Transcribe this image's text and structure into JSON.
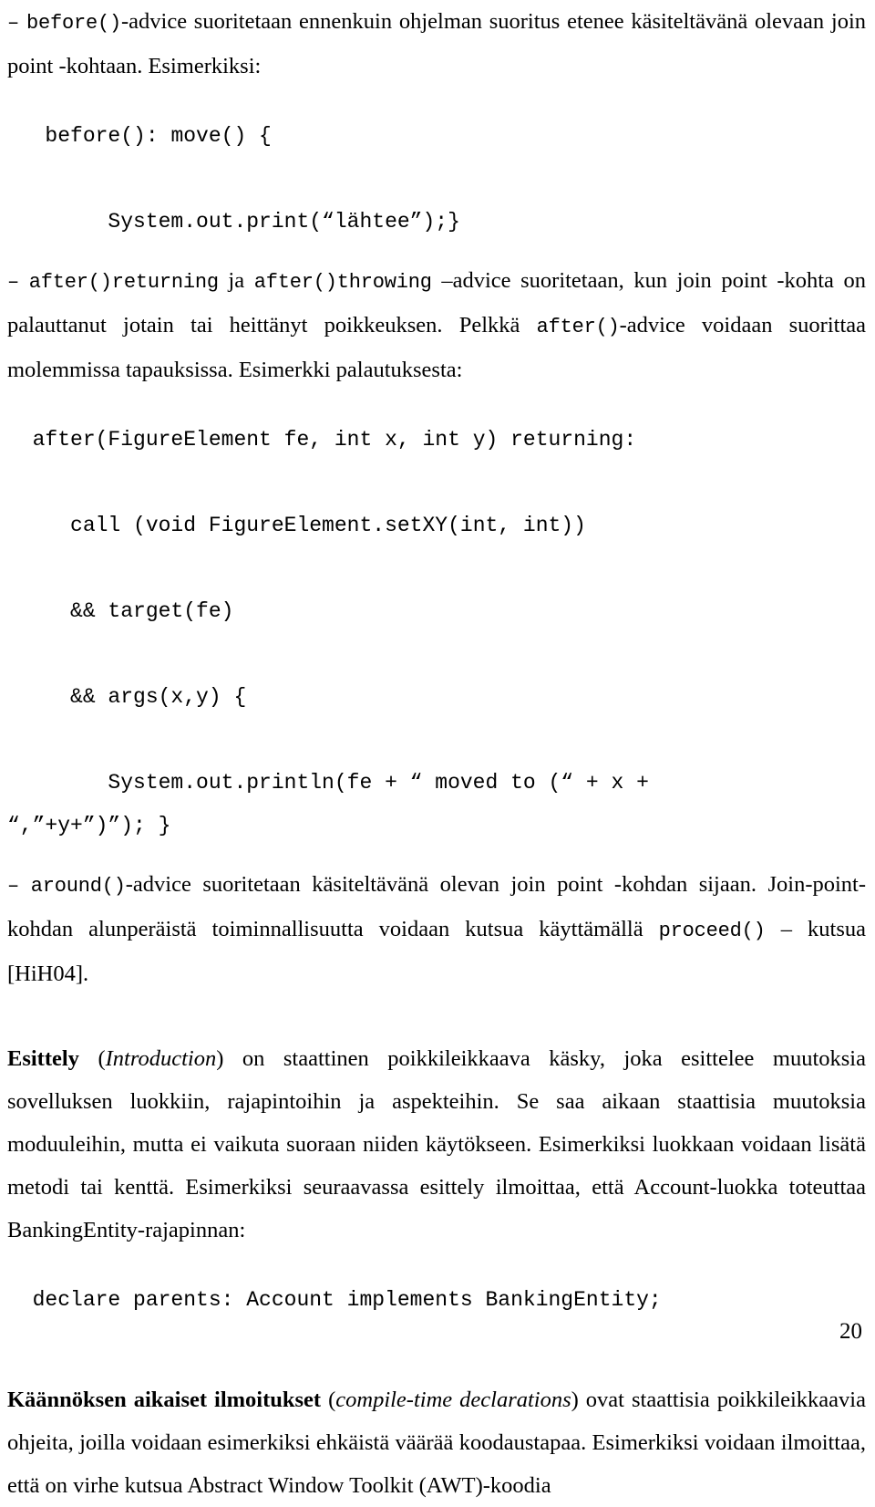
{
  "document": {
    "page_number": "20",
    "language": "fi",
    "blocks": [
      {
        "type": "bullet-paragraph",
        "dash": "–",
        "runs": [
          {
            "style": "mono",
            "text": "before()"
          },
          {
            "style": "normal",
            "text": "-advice suoritetaan ennenkuin ohjelman suoritus etenee käsiteltävänä olevaan join point -kohtaan. Esimerkiksi:"
          }
        ]
      },
      {
        "type": "code",
        "lines": [
          "   before(): move() {",
          "",
          "        System.out.print(“lähtee”);}"
        ]
      },
      {
        "type": "bullet-paragraph",
        "dash": "–",
        "runs": [
          {
            "style": "mono",
            "text": "after()returning"
          },
          {
            "style": "normal",
            "text": " ja "
          },
          {
            "style": "mono",
            "text": "after()throwing"
          },
          {
            "style": "normal",
            "text": " –advice suoritetaan, kun join point -kohta on palauttanut jotain tai heittänyt poikkeuksen. Pelkkä "
          },
          {
            "style": "mono",
            "text": "after()"
          },
          {
            "style": "normal",
            "text": "-advice voidaan suorittaa molemmissa tapauksissa. Esimerkki palautuksesta:"
          }
        ]
      },
      {
        "type": "code",
        "lines": [
          "  after(FigureElement fe, int x, int y) returning:",
          "",
          "     call (void FigureElement.setXY(int, int))",
          "",
          "     && target(fe)",
          "",
          "     && args(x,y) {",
          "",
          "        System.out.println(fe + “ moved to (“ + x +",
          "“,”+y+”)”); }"
        ]
      },
      {
        "type": "bullet-paragraph",
        "dash": "–",
        "runs": [
          {
            "style": "mono",
            "text": "around()"
          },
          {
            "style": "normal",
            "text": "-advice suoritetaan käsiteltävänä olevan join point -kohdan sijaan. Join-point-kohdan alunperäistä toiminnallisuutta voidaan kutsua käyttämällä "
          },
          {
            "style": "mono",
            "text": "proceed()"
          },
          {
            "style": "normal",
            "text": " – kutsua [HiH04]."
          }
        ]
      },
      {
        "type": "paragraph",
        "runs": [
          {
            "style": "bold",
            "text": "Esittely"
          },
          {
            "style": "normal",
            "text": " ("
          },
          {
            "style": "italic",
            "text": "Introduction"
          },
          {
            "style": "normal",
            "text": ") on staattinen poikkileikkaava käsky, joka esittelee muutoksia sovelluksen luokkiin, rajapintoihin ja aspekteihin. Se saa aikaan staattisia muutoksia moduuleihin, mutta ei vaikuta suoraan niiden käytökseen. Esimerkiksi luokkaan voidaan lisätä metodi tai kenttä. Esimerkiksi seuraavassa esittely ilmoittaa, että Account-luokka toteuttaa BankingEntity-rajapinnan:"
          }
        ]
      },
      {
        "type": "code",
        "lines": [
          "  declare parents: Account implements BankingEntity;"
        ]
      },
      {
        "type": "paragraph",
        "runs": [
          {
            "style": "bold",
            "text": "Käännöksen aikaiset ilmoitukset"
          },
          {
            "style": "normal",
            "text": " ("
          },
          {
            "style": "italic",
            "text": "compile-time declarations"
          },
          {
            "style": "normal",
            "text": ") ovat staattisia poikkileikkaavia ohjeita, joilla voidaan esimerkiksi ehkäistä väärää koodaustapaa. Esimerkiksi voidaan ilmoittaa, että on virhe kutsua Abstract Window Toolkit (AWT)-koodia"
          }
        ]
      }
    ]
  }
}
